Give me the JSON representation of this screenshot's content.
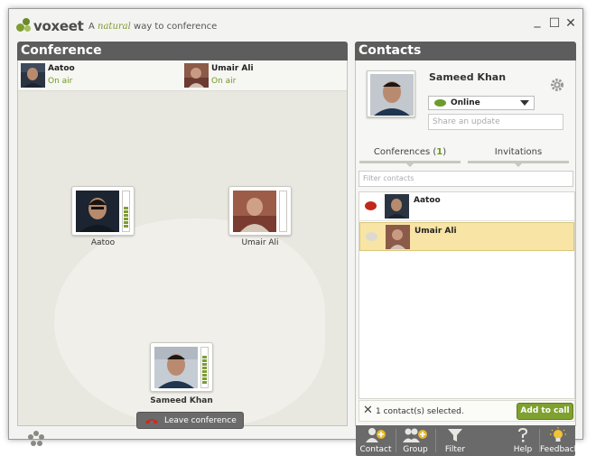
{
  "app": {
    "brand": "voxeet",
    "tagline_prefix": "A",
    "tagline_emphasis": "natural",
    "tagline_suffix": "way to conference",
    "minimize_glyph": "_",
    "maximize_glyph": "☐",
    "close_glyph": "✕"
  },
  "conference": {
    "header": "Conference",
    "participants": [
      {
        "name": "Aatoo",
        "status": "On air",
        "icon": "avatar"
      },
      {
        "name": "Umair Ali",
        "status": "On air",
        "icon": "avatar"
      }
    ],
    "tiles": [
      {
        "name": "Aatoo",
        "audio_level": 0.7
      },
      {
        "name": "Umair Ali",
        "audio_level": 0.0
      },
      {
        "name": "Sameed Khan",
        "audio_level": 0.9
      }
    ],
    "leave_label": "Leave conference",
    "people_icon": "people-icon"
  },
  "contacts": {
    "header": "Contacts",
    "me": {
      "name": "Sameed Khan",
      "status": "Online",
      "status_color": "#6d9a2c",
      "update_placeholder": "Share an update"
    },
    "tabs": {
      "conferences_label": "Conferences (",
      "conferences_count": "1",
      "conferences_close": ")",
      "invitations_label": "Invitations"
    },
    "filter_placeholder": "Filter contacts",
    "list": [
      {
        "name": "Aatoo",
        "bubble_color": "#c0281c",
        "selected": false
      },
      {
        "name": "Umair Ali",
        "bubble_color": "#d8d8d0",
        "selected": true
      }
    ],
    "selection_text": "1 contact(s) selected.",
    "clear_glyph": "✕",
    "add_to_call": "Add to call",
    "toolbar": {
      "contact": "Contact",
      "group": "Group",
      "filter": "Filter",
      "help": "Help",
      "feedback": "Feedback"
    }
  },
  "colors": {
    "accent_green": "#7ea12f",
    "header_gray": "#5d5d5d",
    "selection_yellow": "#f8e4a4"
  }
}
